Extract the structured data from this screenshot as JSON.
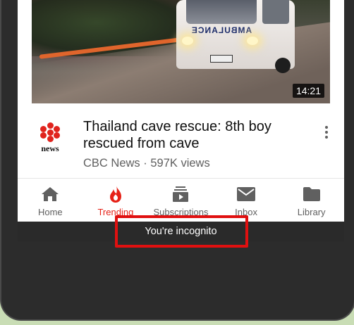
{
  "video": {
    "duration": "14:21",
    "thumbnail_text": "AMBULANCE",
    "channel_logo_text": "news",
    "title": "Thailand cave rescue: 8th boy rescued from cave",
    "meta": "CBC News · 597K views"
  },
  "bottom_nav": {
    "items": [
      {
        "label": "Home",
        "icon": "home-icon"
      },
      {
        "label": "Trending",
        "icon": "flame-icon"
      },
      {
        "label": "Subscriptions",
        "icon": "subscriptions-icon"
      },
      {
        "label": "Inbox",
        "icon": "mail-icon"
      },
      {
        "label": "Library",
        "icon": "folder-icon"
      }
    ],
    "active": "Trending"
  },
  "status": {
    "incognito_text": "You're incognito"
  },
  "colors": {
    "accent": "#e62117",
    "highlight": "#e01010",
    "background": "#c9ddb5"
  }
}
